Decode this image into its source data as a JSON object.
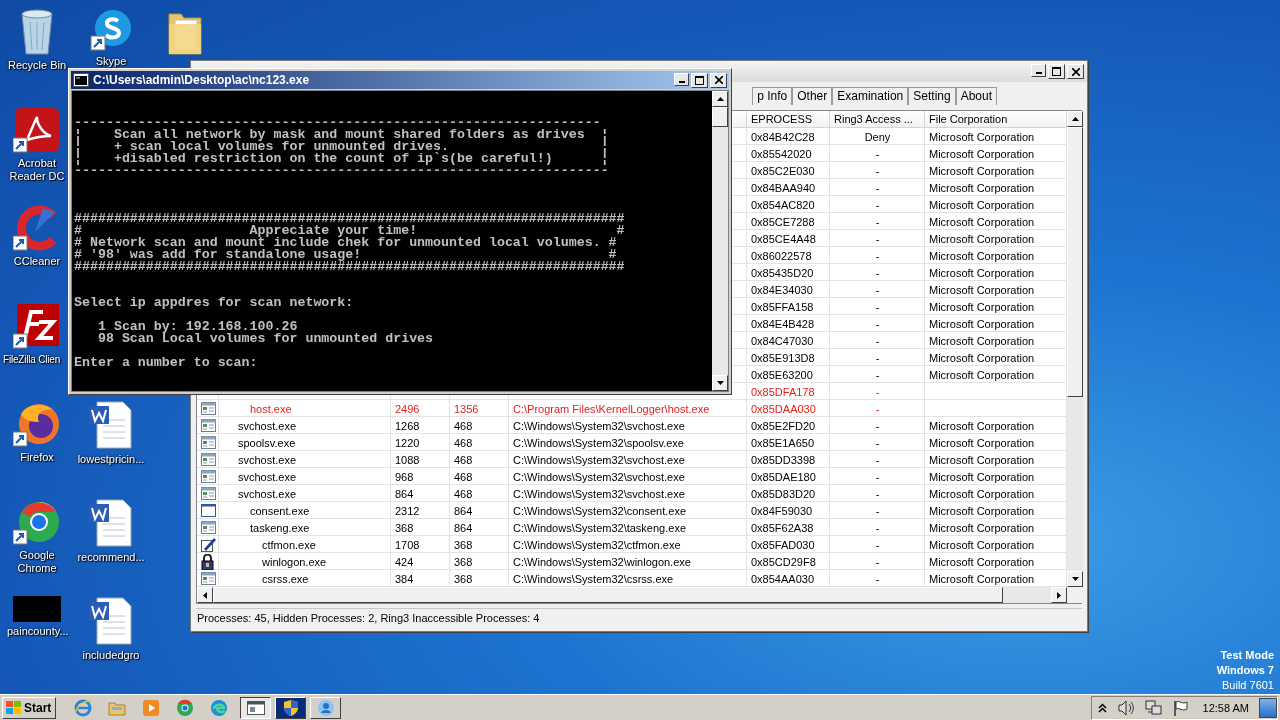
{
  "desktop": {
    "icons": [
      {
        "label": "Recycle Bin",
        "kind": "recycle"
      },
      {
        "label": "Skype",
        "kind": "skype"
      },
      {
        "kind": "folder"
      },
      {
        "label": "Acrobat Reader DC",
        "kind": "pdf"
      },
      {
        "label": "CCleaner",
        "kind": "ccleaner"
      },
      {
        "label": "FileZilla Clien",
        "kind": "filezilla"
      },
      {
        "label": "Firefox",
        "kind": "firefox"
      },
      {
        "label": "lowestpricin...",
        "kind": "word"
      },
      {
        "label": "Google Chrome",
        "kind": "chrome"
      },
      {
        "label": "recommend...",
        "kind": "word"
      },
      {
        "label": "paincounty...",
        "kind": "black"
      },
      {
        "label": "includedgro",
        "kind": "word"
      }
    ],
    "os_notice": [
      "Test Mode",
      "Windows 7",
      "Build 7601"
    ]
  },
  "process_window": {
    "tabs": [
      {
        "label": "p Info",
        "selected": false
      },
      {
        "label": "Other",
        "selected": false
      },
      {
        "label": "Examination",
        "selected": false
      },
      {
        "label": "Setting",
        "selected": false
      },
      {
        "label": "About",
        "selected": false
      }
    ],
    "table": {
      "columns": [
        "EPROCESS",
        "Ring3 Access ...",
        "File Corporation"
      ],
      "rows": [
        {
          "eprocess": "0x84B42C28",
          "ring3": "Deny",
          "corp": "Microsoft Corporation",
          "hidden": false
        },
        {
          "eprocess": "0x85542020",
          "ring3": "-",
          "corp": "Microsoft Corporation",
          "hidden": false
        },
        {
          "eprocess": "0x85C2E030",
          "ring3": "-",
          "corp": "Microsoft Corporation",
          "hidden": false
        },
        {
          "eprocess": "0x84BAA940",
          "ring3": "-",
          "corp": "Microsoft Corporation",
          "hidden": false
        },
        {
          "eprocess": "0x854AC820",
          "ring3": "-",
          "corp": "Microsoft Corporation",
          "hidden": false
        },
        {
          "eprocess": "0x85CE7288",
          "ring3": "-",
          "corp": "Microsoft Corporation",
          "hidden": false
        },
        {
          "eprocess": "0x85CE4A48",
          "ring3": "-",
          "corp": "Microsoft Corporation",
          "hidden": false
        },
        {
          "eprocess": "0x86022578",
          "ring3": "-",
          "corp": "Microsoft Corporation",
          "hidden": false
        },
        {
          "eprocess": "0x85435D20",
          "ring3": "-",
          "corp": "Microsoft Corporation",
          "hidden": false
        },
        {
          "eprocess": "0x84E34030",
          "ring3": "-",
          "corp": "Microsoft Corporation",
          "hidden": false
        },
        {
          "eprocess": "0x85FFA158",
          "ring3": "-",
          "corp": "Microsoft Corporation",
          "hidden": false
        },
        {
          "eprocess": "0x84E4B428",
          "ring3": "-",
          "corp": "Microsoft Corporation",
          "hidden": false
        },
        {
          "eprocess": "0x84C47030",
          "ring3": "-",
          "corp": "Microsoft Corporation",
          "hidden": false
        },
        {
          "eprocess": "0x85E913D8",
          "ring3": "-",
          "corp": "Microsoft Corporation",
          "hidden": false
        },
        {
          "eprocess": "0x85E63200",
          "ring3": "-",
          "corp": "Microsoft Corporation",
          "hidden": false
        },
        {
          "eprocess": "0x85DFA178",
          "ring3": "-",
          "hidden": true,
          "children": [
            {
              "kind": "app",
              "name": "host.exe",
              "pid": "2496",
              "ppid": "1356",
              "path": "C:\\Program Files\\KernelLogger\\host.exe",
              "eprocess": "0x85DAA030",
              "ring3": "-",
              "hidden": true
            }
          ]
        },
        {
          "kind": "app",
          "name": "svchost.exe",
          "pid": "1268",
          "ppid": "468",
          "path": "C:\\Windows\\System32\\svchost.exe",
          "eprocess": "0x85E2FD20",
          "ring3": "-",
          "corp": "Microsoft Corporation",
          "hidden": false
        },
        {
          "kind": "app",
          "name": "spoolsv.exe",
          "pid": "1220",
          "ppid": "468",
          "path": "C:\\Windows\\System32\\spoolsv.exe",
          "eprocess": "0x85E1A650",
          "ring3": "-",
          "corp": "Microsoft Corporation",
          "hidden": false
        },
        {
          "kind": "app",
          "name": "svchost.exe",
          "pid": "1088",
          "ppid": "468",
          "path": "C:\\Windows\\System32\\svchost.exe",
          "eprocess": "0x85DD3398",
          "ring3": "-",
          "corp": "Microsoft Corporation",
          "hidden": false
        },
        {
          "kind": "app",
          "name": "svchost.exe",
          "pid": "968",
          "ppid": "468",
          "path": "C:\\Windows\\System32\\svchost.exe",
          "eprocess": "0x85DAE180",
          "ring3": "-",
          "corp": "Microsoft Corporation",
          "hidden": false
        },
        {
          "kind": "app",
          "name": "svchost.exe",
          "pid": "864",
          "ppid": "468",
          "path": "C:\\Windows\\System32\\svchost.exe",
          "eprocess": "0x85D83D20",
          "ring3": "-",
          "corp": "Microsoft Corporation",
          "hidden": false,
          "children": [
            {
              "kind": "blank",
              "name": "consent.exe",
              "pid": "2312",
              "ppid": "864",
              "path": "C:\\Windows\\System32\\consent.exe",
              "eprocess": "0x84F59030",
              "ring3": "-",
              "corp": "Microsoft Corporation",
              "hidden": false
            },
            {
              "kind": "app",
              "name": "taskeng.exe",
              "pid": "368",
              "ppid": "864",
              "path": "C:\\Windows\\System32\\taskeng.exe",
              "eprocess": "0x85F62A38",
              "ring3": "-",
              "corp": "Microsoft Corporation",
              "hidden": false,
              "children": [
                {
                  "kind": "pen",
                  "name": "ctfmon.exe",
                  "pid": "1708",
                  "ppid": "368",
                  "path": "C:\\Windows\\System32\\ctfmon.exe",
                  "eprocess": "0x85FAD030",
                  "ring3": "-",
                  "corp": "Microsoft Corporation",
                  "hidden": false
                },
                {
                  "kind": "lock",
                  "name": "winlogon.exe",
                  "pid": "424",
                  "ppid": "368",
                  "path": "C:\\Windows\\System32\\winlogon.exe",
                  "eprocess": "0x85CD29F8",
                  "ring3": "-",
                  "corp": "Microsoft Corporation",
                  "hidden": false
                },
                {
                  "kind": "app",
                  "name": "csrss.exe",
                  "pid": "384",
                  "ppid": "368",
                  "path": "C:\\Windows\\System32\\csrss.exe",
                  "eprocess": "0x854AA030",
                  "ring3": "-",
                  "corp": "Microsoft Corporation",
                  "hidden": false
                }
              ]
            }
          ]
        }
      ]
    },
    "status_bar": "Processes: 45, Hidden Processes: 2, Ring3 Inaccessible Processes: 4"
  },
  "console_window": {
    "title": "C:\\Users\\admin\\Desktop\\ac\\nc123.exe",
    "blocks": [
      [
        "------------------------------------------------------------------",
        "¦    Scan all network by mask and mount shared folders as drives  ¦",
        "¦    + scan local volumes for unmounted drives.                   ¦",
        "¦    +disabled restriction on the count of ip`s(be careful!)      ¦",
        "-------------------------------------------------------------------"
      ],
      [
        "#####################################################################",
        "#                     Appreciate your time!                         #",
        "# Network scan and mount include chek for unmounted local volumes. #",
        "# '98' was add for standalone usage!                               #",
        "#####################################################################"
      ],
      [
        "Select ip appdres for scan network:"
      ],
      [
        "   1 Scan by: 192.168.100.26",
        "   98 Scan Local volumes for unmounted drives"
      ],
      [
        "Enter a number to scan:"
      ]
    ]
  },
  "taskbar": {
    "start": "Start",
    "quick_launch": [
      {
        "kind": "ie"
      },
      {
        "kind": "explorer"
      },
      {
        "kind": "media"
      },
      {
        "kind": "chrome"
      },
      {
        "kind": "edge"
      }
    ],
    "tasks": [
      {
        "kind": "window",
        "selected": true
      },
      {
        "kind": "shield",
        "selected": false
      },
      {
        "kind": "person",
        "selected": false
      }
    ],
    "clock": "12:58 AM"
  }
}
